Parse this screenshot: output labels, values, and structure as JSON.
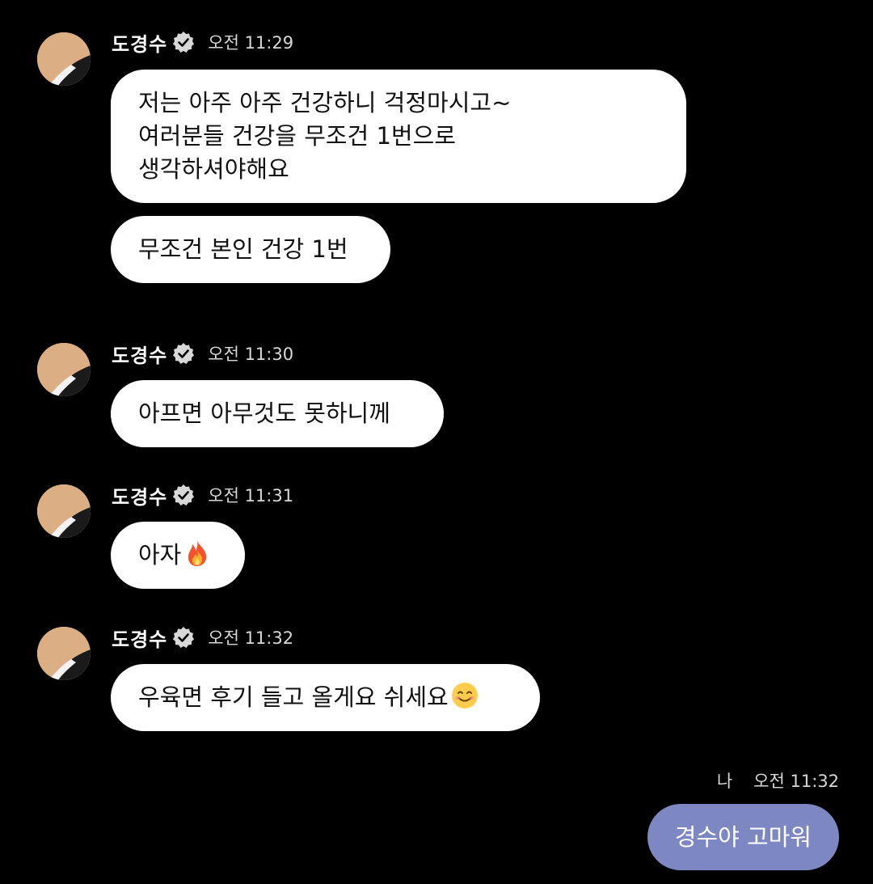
{
  "colors": {
    "background": "#000000",
    "incoming_bubble": "#ffffff",
    "outgoing_bubble": "#7d88c3",
    "meta_text": "#d8d8d8"
  },
  "messages": [
    {
      "sender": "도경수",
      "time": "오전 11:29",
      "bubbles": [
        "저는 아주 아주 건강하니 걱정마시고~\n여러분들 건강을 무조건 1번으로\n생각하셔야해요",
        "무조건 본인 건강 1번"
      ]
    },
    {
      "sender": "도경수",
      "time": "오전 11:30",
      "bubbles": [
        "아프면 아무것도 못하니께"
      ]
    },
    {
      "sender": "도경수",
      "time": "오전 11:31",
      "bubbles": [
        "아자"
      ],
      "emoji": "fire-emoji"
    },
    {
      "sender": "도경수",
      "time": "오전 11:32",
      "bubbles": [
        "우육면 후기 들고 올게요 쉬세요"
      ],
      "emoji": "smiling-face-emoji"
    }
  ],
  "my_reply": {
    "label": "나",
    "time": "오전 11:32",
    "text": "경수야 고마워"
  },
  "icons": {
    "verified": "verified-badge-icon",
    "avatar": "profile-avatar"
  }
}
